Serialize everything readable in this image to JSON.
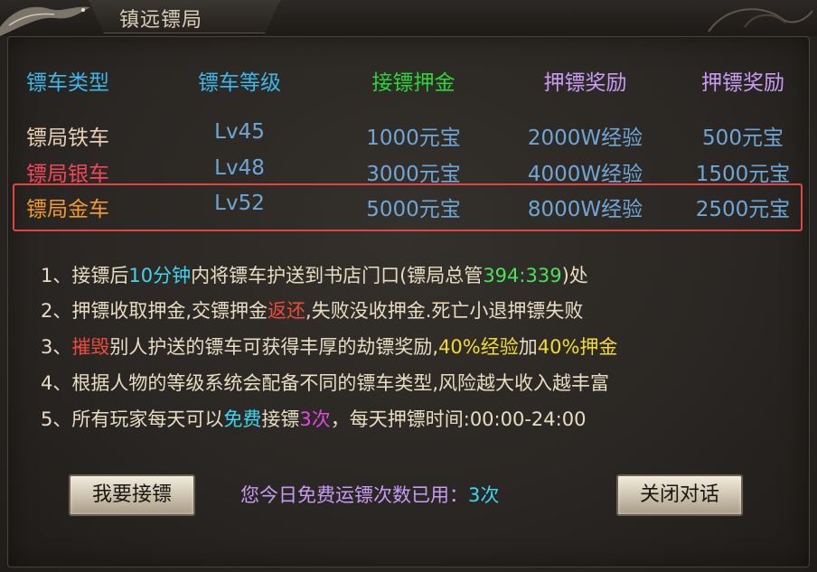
{
  "window": {
    "title": "镇远镖局"
  },
  "colors": {
    "header_blue": "#3fb6e8",
    "header_green": "#2fd33a",
    "header_purple": "#c89cf2",
    "value_blue": "#6ea6d6",
    "highlight_red": "#e04545",
    "cyan": "#3fd6ef",
    "red": "#ef4a3e",
    "yellow": "#f3dc2a",
    "magenta": "#e04be0",
    "green": "#4ee05a"
  },
  "table": {
    "headers": [
      {
        "label": "镖车类型",
        "color": "#3fb6e8"
      },
      {
        "label": "镖车等级",
        "color": "#3fb6e8"
      },
      {
        "label": "接镖押金",
        "color": "#2fd33a"
      },
      {
        "label": "押镖奖励",
        "color": "#c89cf2"
      },
      {
        "label": "押镖奖励",
        "color": "#c89cf2"
      }
    ],
    "rows": [
      {
        "type": "镖局铁车",
        "type_color": "#e9cdb5",
        "level": "Lv45",
        "deposit": "1000元宝",
        "exp_reward": "2000W经验",
        "gold_reward": "500元宝"
      },
      {
        "type": "镖局银车",
        "type_color": "#f0485a",
        "level": "Lv48",
        "deposit": "3000元宝",
        "exp_reward": "4000W经验",
        "gold_reward": "1500元宝"
      },
      {
        "type": "镖局金车",
        "type_color": "#f29a2c",
        "level": "Lv52",
        "deposit": "5000元宝",
        "exp_reward": "8000W经验",
        "gold_reward": "2500元宝"
      }
    ],
    "highlighted_row": "镖局金车"
  },
  "rules": [
    [
      {
        "text": "1、接镖后",
        "color": "#e8dcc2"
      },
      {
        "text": "10分钟",
        "color": "#3fd6ef"
      },
      {
        "text": "内将镖车护送到书店门口(镖局总管",
        "color": "#e8dcc2"
      },
      {
        "text": "394:339",
        "color": "#4ee05a"
      },
      {
        "text": ")处",
        "color": "#e8dcc2"
      }
    ],
    [
      {
        "text": "2、押镖收取押金,交镖押金",
        "color": "#e8dcc2"
      },
      {
        "text": "返还",
        "color": "#ef4a3e"
      },
      {
        "text": ",失败没收押金.死亡小退押镖失败",
        "color": "#e8dcc2"
      }
    ],
    [
      {
        "text": "3、",
        "color": "#e8dcc2"
      },
      {
        "text": "摧毁",
        "color": "#ef4a3e"
      },
      {
        "text": "别人护送的镖车可获得丰厚的劫镖奖励,",
        "color": "#e8dcc2"
      },
      {
        "text": "40%经验",
        "color": "#f3dc2a"
      },
      {
        "text": "加",
        "color": "#e8dcc2"
      },
      {
        "text": "40%押金",
        "color": "#f3dc2a"
      }
    ],
    [
      {
        "text": "4、根据人物的等级系统会配备不同的镖车类型,风险越大收入越丰富",
        "color": "#e8dcc2"
      }
    ],
    [
      {
        "text": "5、所有玩家每天可以",
        "color": "#e8dcc2"
      },
      {
        "text": "免费",
        "color": "#3fd6ef"
      },
      {
        "text": "接镖",
        "color": "#e8dcc2"
      },
      {
        "text": "3次",
        "color": "#e04be0"
      },
      {
        "text": "，每天押镖时间:00:00-24:00",
        "color": "#e8dcc2"
      }
    ]
  ],
  "footer": {
    "accept_button": "我要接镖",
    "status_label": "您今日免费运镖次数已用：",
    "status_label_color": "#c89cf2",
    "status_count": "3次",
    "status_count_color": "#3fd6ef",
    "close_button": "关闭对话"
  }
}
